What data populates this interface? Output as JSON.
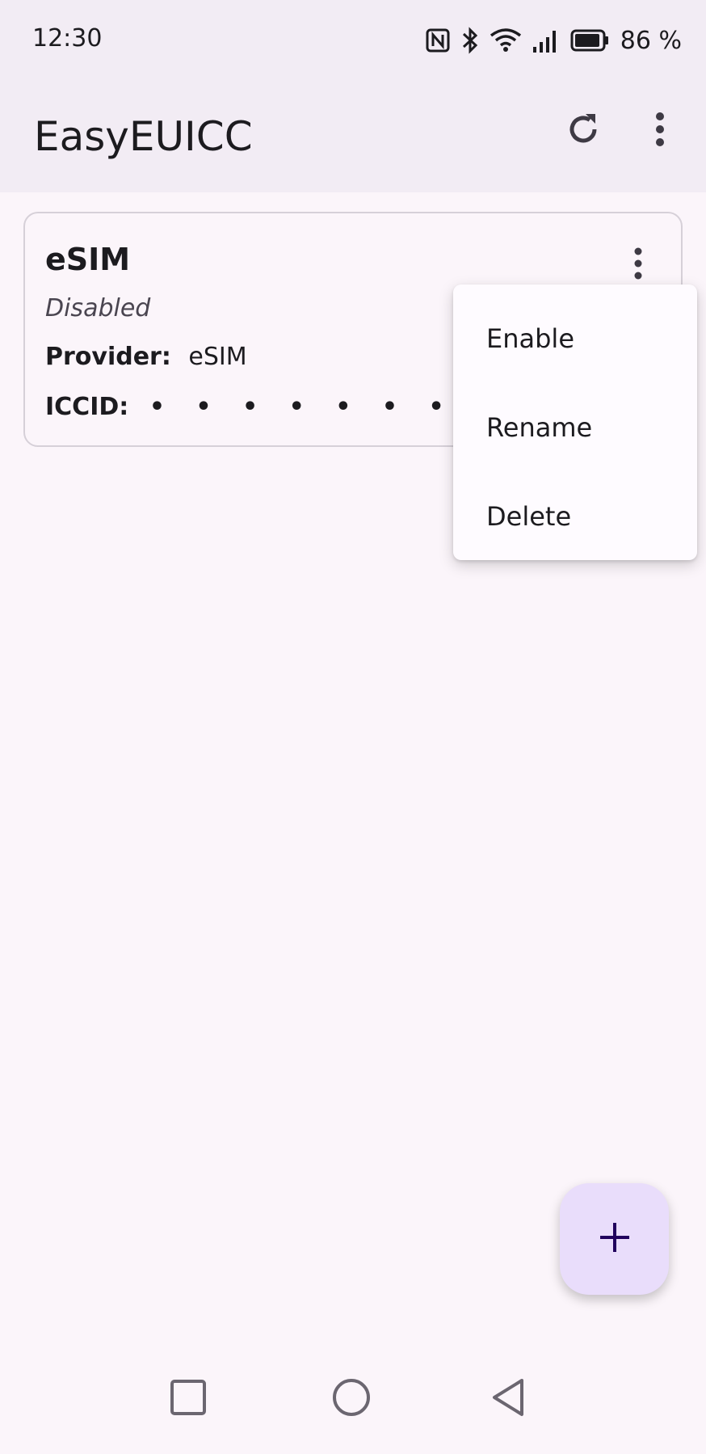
{
  "status_bar": {
    "time": "12:30",
    "battery": "86 %",
    "icons": [
      "nfc-icon",
      "bluetooth-icon",
      "wifi-icon",
      "cell-signal-icon",
      "battery-icon"
    ]
  },
  "app_bar": {
    "title": "EasyEUICC",
    "actions": [
      "refresh-icon",
      "more-vert-icon"
    ]
  },
  "profile_card": {
    "name": "eSIM",
    "status": "Disabled",
    "provider_label": "Provider:",
    "provider_value": "eSIM",
    "iccid_label": "ICCID:",
    "iccid_value": "• • • • • • • • • • • • •"
  },
  "popup_menu": {
    "items": [
      "Enable",
      "Rename",
      "Delete"
    ]
  },
  "fab": {
    "icon": "plus-icon"
  },
  "nav_bar": {
    "icons": [
      "recents-icon",
      "home-icon",
      "back-icon"
    ]
  },
  "colors": {
    "background": "#fbf5fa",
    "top_bar": "#f2ecf4",
    "fab": "#e9ddfb",
    "fab_icon": "#21005d",
    "text": "#1c1b1f"
  }
}
